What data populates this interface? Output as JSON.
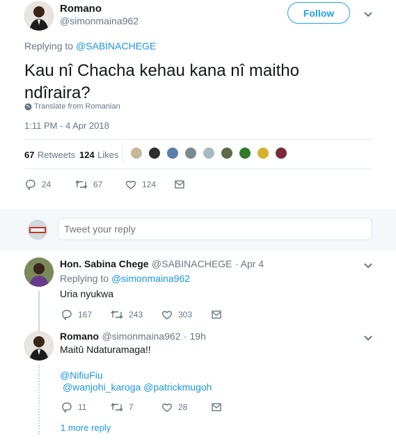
{
  "main_tweet": {
    "author_name": "Romano",
    "author_handle": "@simonmaina962",
    "follow_label": "Follow",
    "replying_prefix": "Replying to",
    "replying_to": "@SABINACHEGE",
    "text_line1": "Kau  nî Chacha kehau kana nî maitho",
    "text_line2": "ndîraira?",
    "translate_label": "Translate from Romanian",
    "timestamp": "1:11 PM - 4 Apr 2018",
    "retweets_count": "67",
    "retweets_label": "Retweets",
    "likes_count": "124",
    "likes_label": "Likes",
    "actions": {
      "replies": "24",
      "retweets": "67",
      "likes": "124"
    }
  },
  "reply_box": {
    "placeholder": "Tweet your reply"
  },
  "replies": [
    {
      "author_name": "Hon. Sabina Chege",
      "author_handle": "@SABINACHEGE",
      "time": "· Apr 4",
      "replying_prefix": "Replying to",
      "replying_to": "@simonmaina962",
      "text": "Uria nyukwa",
      "actions": {
        "replies": "167",
        "retweets": "243",
        "likes": "303"
      }
    },
    {
      "author_name": "Romano",
      "author_handle": "@simonmaina962",
      "time": "· 19h",
      "text": "Maitû Ndaturamaga!!",
      "mention1": "@NifiuFiu",
      "mention2": "@wanjohi_karoga",
      "mention3": "@patrickmugoh",
      "actions": {
        "replies": "11",
        "retweets": "7",
        "likes": "28"
      }
    }
  ],
  "more_replies_label": "1 more reply",
  "colors": {
    "accent": "#1da1f2",
    "link": "#1b95e0",
    "muted": "#657786"
  }
}
